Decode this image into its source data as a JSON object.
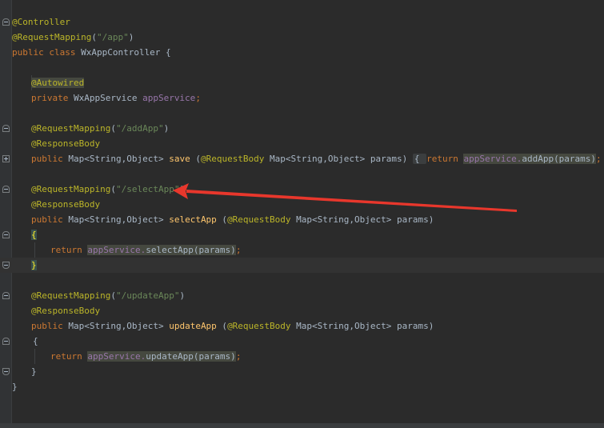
{
  "editor": {
    "lines": {
      "l1_controller": "@Controller",
      "l2_request_mapping": "@RequestMapping",
      "l2_paren_open": "(",
      "l2_path": "\"/app\"",
      "l2_paren_close": ")",
      "l3_public": "public class ",
      "l3_classname": "WxAppController {",
      "l5_autowired": "@Autowired",
      "l6_private": "private ",
      "l6_type": "WxAppService ",
      "l6_field": "appService",
      "l6_semicolon": ";",
      "l8_rm": "@RequestMapping",
      "l8_paren_open": "(",
      "l8_path": "\"/addApp\"",
      "l8_paren_close": ")",
      "l9_rb": "@ResponseBody",
      "l10_public": "public ",
      "l10_type": "Map<String,Object> ",
      "l10_method": "save",
      "l10_space_paren": " (",
      "l10_ann": "@RequestBody ",
      "l10_param_type": "Map<String,Object> params) ",
      "l10_brace_open": "{ ",
      "l10_return": "return ",
      "l10_field": "appService.",
      "l10_call": "addApp(params)",
      "l10_semi": "; ",
      "l10_brace_close": "}",
      "l12_rm": "@RequestMapping",
      "l12_paren_open": "(",
      "l12_path": "\"/selectApp\"",
      "l12_paren_close": ")",
      "l13_rb": "@ResponseBody",
      "l14_public": "public ",
      "l14_type": "Map<String,Object> ",
      "l14_method": "selectApp",
      "l14_space_paren": " (",
      "l14_ann": "@RequestBody ",
      "l14_param_type": "Map<String,Object> params)",
      "l15_brace_open": "{",
      "l16_return": "return ",
      "l16_field": "appService.",
      "l16_call": "selectApp(params)",
      "l16_semi": ";",
      "l17_brace_close": "}",
      "l19_rm": "@RequestMapping",
      "l19_paren_open": "(",
      "l19_path": "\"/updateApp\"",
      "l19_paren_close": ")",
      "l20_rb": "@ResponseBody",
      "l21_public": "public ",
      "l21_type": "Map<String,Object> ",
      "l21_method": "updateApp",
      "l21_space_paren": " (",
      "l21_ann": "@RequestBody ",
      "l21_param_type": "Map<String,Object> params)",
      "l22_brace_open": "{",
      "l23_return": "return ",
      "l23_field": "appService.",
      "l23_call": "updateApp(params)",
      "l23_semi": ";",
      "l24_brace_close": "}",
      "l25_brace_close": "}"
    }
  },
  "annotation_arrow": {
    "color": "#e8372c",
    "points_to": "selectApp mapping"
  },
  "colors": {
    "background": "#2b2b2b",
    "keyword": "#cc7832",
    "annotation": "#bbb529",
    "string": "#6a8759",
    "method": "#ffc66d",
    "field": "#9876aa",
    "text": "#a9b7c6"
  }
}
